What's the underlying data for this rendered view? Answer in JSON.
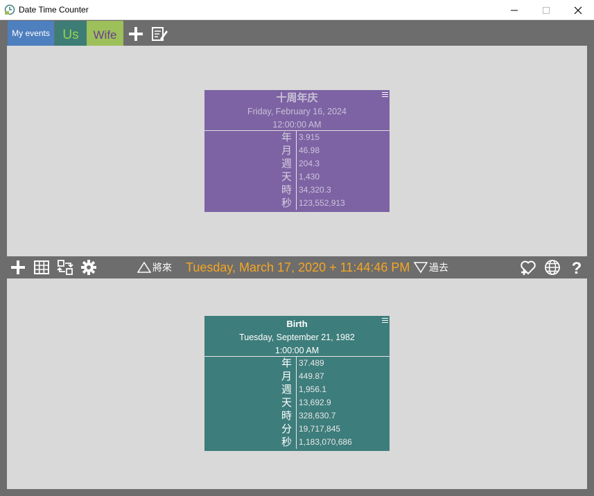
{
  "window": {
    "title": "Date Time Counter"
  },
  "tabs": [
    {
      "label": "My events"
    },
    {
      "label": "Us"
    },
    {
      "label": "Wife"
    }
  ],
  "toolbar": {
    "current_datetime": "Tuesday, March 17, 2020 + 11:44:46 PM",
    "future_label": "將來",
    "past_label": "過去",
    "help_label": "?"
  },
  "events": [
    {
      "name": "十周年庆",
      "date": "Friday, February 16, 2024",
      "time": "12:00:00 AM",
      "color": "#7d63a3",
      "rows": [
        {
          "unit": "年",
          "value": "3.915"
        },
        {
          "unit": "月",
          "value": "46.98"
        },
        {
          "unit": "週",
          "value": "204.3"
        },
        {
          "unit": "天",
          "value": "1,430"
        },
        {
          "unit": "時",
          "value": "34,320.3"
        },
        {
          "unit": "秒",
          "value": "123,552,913"
        }
      ]
    },
    {
      "name": "Birth",
      "date": "Tuesday, September 21, 1982",
      "time": "1:00:00 AM",
      "color": "#3d7d7b",
      "rows": [
        {
          "unit": "年",
          "value": "37.489"
        },
        {
          "unit": "月",
          "value": "449.87"
        },
        {
          "unit": "週",
          "value": "1,956.1"
        },
        {
          "unit": "天",
          "value": "13,692.9"
        },
        {
          "unit": "時",
          "value": "328,630.7"
        },
        {
          "unit": "分",
          "value": "19,717,845"
        },
        {
          "unit": "秒",
          "value": "1,183,070,686"
        }
      ]
    }
  ],
  "icons": {
    "app": "clock-app-icon",
    "minimize": "minimize-icon",
    "maximize": "maximize-icon",
    "close": "close-icon",
    "add_tab": "plus-icon",
    "edit_tabs": "edit-list-icon",
    "add_event": "plus-icon",
    "grid": "grid-icon",
    "swap": "swap-icon",
    "settings": "gear-icon",
    "future": "triangle-up-icon",
    "past": "triangle-down-icon",
    "favorite": "heart-plus-icon",
    "language": "globe-icon",
    "help": "help-icon",
    "card_menu": "menu-icon"
  },
  "colors": {
    "background": "#6d6d6d",
    "panel": "#d9d9d9",
    "tab_my_events": "#4e7fbf",
    "tab_us": "#3d7d76",
    "tab_wife": "#9dc05a",
    "datetime_accent": "#f5a623"
  }
}
